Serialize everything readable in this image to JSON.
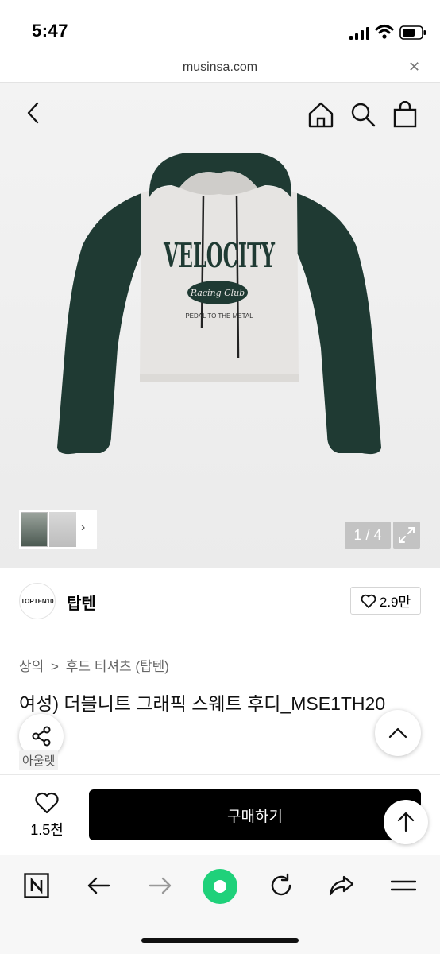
{
  "status_bar": {
    "time": "5:47"
  },
  "url_bar": {
    "domain": "musinsa.com",
    "close_glyph": "✕"
  },
  "gallery": {
    "page_indicator": "1 / 4",
    "product_graphic": {
      "headline": "VELOCITY",
      "badge": "Racing Club",
      "tagline": "PEDAL TO THE METAL"
    }
  },
  "brand": {
    "logo_text": "TOPTEN10",
    "name": "탑텐",
    "likes": "2.9만"
  },
  "breadcrumb": {
    "category": "상의",
    "separator": ">",
    "subcategory": "후드 티셔츠 (탑텐)"
  },
  "product": {
    "title": "여성) 더블니트 그래픽 스웨트 후디_MSE1TH20",
    "tag": "아울렛"
  },
  "purchase_bar": {
    "wish_count": "1.5천",
    "buy_label": "구매하기"
  },
  "colors": {
    "accent_green": "#1fd17a",
    "hoodie_green": "#1f3a33",
    "hoodie_body": "#e6e4e2"
  },
  "icons": [
    "back-icon",
    "home-icon",
    "search-icon",
    "bag-icon",
    "expand-icon",
    "heart-icon",
    "share-icon",
    "chevron-up-icon",
    "arrow-up-icon",
    "naver-n-icon",
    "browser-back-icon",
    "browser-forward-icon",
    "green-dot-icon",
    "refresh-icon",
    "forward-share-icon",
    "menu-icon"
  ]
}
